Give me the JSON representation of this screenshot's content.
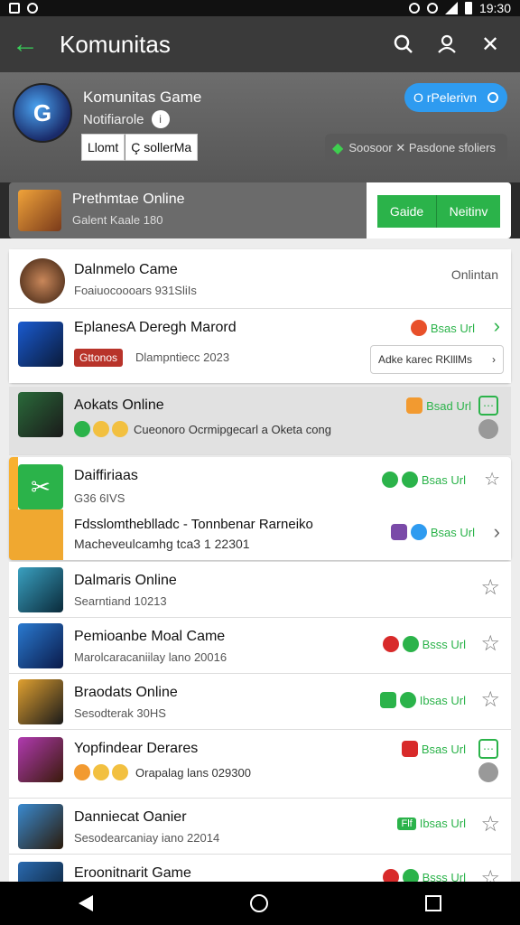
{
  "status": {
    "time": "19:30"
  },
  "appbar": {
    "title": "Komunitas"
  },
  "header": {
    "title": "Komunitas Game",
    "subtitle": "Notifiarole",
    "btn1": "Llomt",
    "btn2": "Ç sollerMa",
    "blue_pill": "O rPelerivn",
    "green_chip": "Soosoor ✕ Pasdone sfoliers"
  },
  "featured": {
    "title": "Prethmtae Online",
    "sub": "Galent Kaale 180",
    "btn1": "Gaide",
    "btn2": "Neitinv"
  },
  "rows": [
    {
      "title": "Dalnmelo Came",
      "sub": "Foaiuocoooars 931SliIs",
      "right": "Onlintan"
    },
    {
      "title": "EplanesA Deregh Marord",
      "sub": "Dlampntiecc 2023",
      "tag": "Gttonos",
      "badge": "Bsas Url",
      "button": "Adke karec RKlllMs"
    },
    {
      "title": "Aokats Online",
      "sub": "Cueonoro Ocrmipgecarl a Oketa cong",
      "badge": "Bsad Url"
    },
    {
      "title": "Daiffiriaas",
      "sub": "G36 6IVS",
      "badge": "Bsas Url"
    },
    {
      "title": "Fdsslomtheblladc - Tonnbenar Rarneiko",
      "sub": "Macheveulcamhg tca3 1 22301",
      "badge": "Bsas Url"
    },
    {
      "title": "Dalmaris Online",
      "sub": "Searntiand 10213"
    },
    {
      "title": "Pemioanbe Moal Came",
      "sub": "Marolcaracaniilay lano 20016",
      "badge": "Bsss Url"
    },
    {
      "title": "Braodats Online",
      "sub": "Sesodterak 30HS",
      "badge": "Ibsas Url"
    },
    {
      "title": "Yopfindear Derares",
      "sub": "Orapalag lans 029300",
      "badge": "Bsas Url"
    },
    {
      "title": "Danniecat Oanier",
      "sub": "Sesodearcaniay iano 22014",
      "badge": "Ibsas Url",
      "tag": "Flf"
    },
    {
      "title": "Eroonitnarit Game",
      "badge": "Bsss Url"
    }
  ],
  "colors": {
    "accent": "#2bb34a",
    "blue": "#2e9bf0",
    "appbar": "#3a3a3a"
  }
}
